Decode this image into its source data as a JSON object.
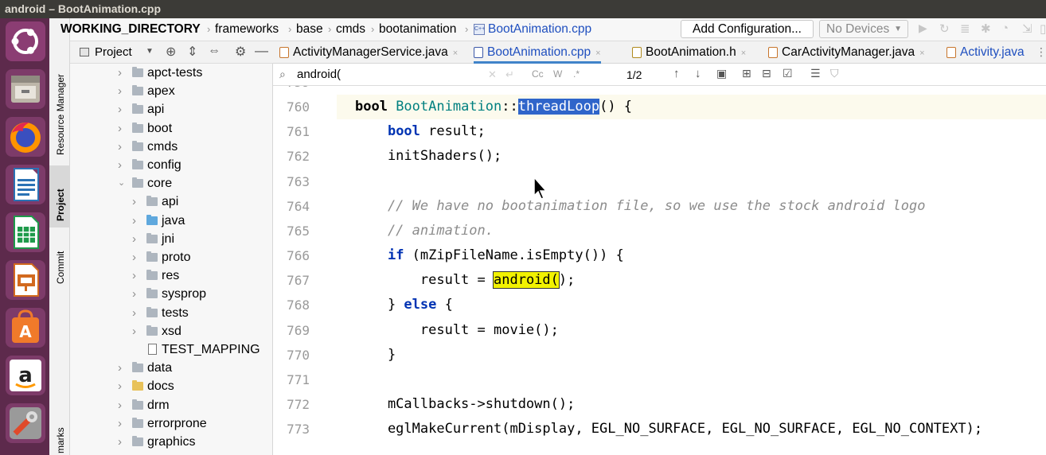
{
  "window": {
    "title": "android – BootAnimation.cpp"
  },
  "launcher": {
    "apps": [
      "ubuntu-dash-icon",
      "files-icon",
      "firefox-icon",
      "writer-icon",
      "calc-icon",
      "impress-icon",
      "software-center-icon",
      "amazon-icon",
      "settings-icon"
    ]
  },
  "tool_windows": {
    "resource_manager": "Resource Manager",
    "project": "Project",
    "commit": "Commit",
    "bookmarks": "marks"
  },
  "navbar": {
    "crumbs": [
      "WORKING_DIRECTORY",
      "frameworks",
      "base",
      "cmds",
      "bootanimation",
      "BootAnimation.cpp"
    ],
    "add_configuration": "Add Configuration...",
    "devices": "No Devices"
  },
  "project_panel": {
    "title": "Project"
  },
  "tree": [
    {
      "label": "apct-tests",
      "depth": 0,
      "expanded": false,
      "type": "folder"
    },
    {
      "label": "apex",
      "depth": 0,
      "expanded": false,
      "type": "folder"
    },
    {
      "label": "api",
      "depth": 0,
      "expanded": false,
      "type": "folder"
    },
    {
      "label": "boot",
      "depth": 0,
      "expanded": false,
      "type": "folder"
    },
    {
      "label": "cmds",
      "depth": 0,
      "expanded": false,
      "type": "folder"
    },
    {
      "label": "config",
      "depth": 0,
      "expanded": false,
      "type": "folder"
    },
    {
      "label": "core",
      "depth": 0,
      "expanded": true,
      "type": "folder"
    },
    {
      "label": "api",
      "depth": 1,
      "expanded": false,
      "type": "folder"
    },
    {
      "label": "java",
      "depth": 1,
      "expanded": false,
      "type": "folder-blue"
    },
    {
      "label": "jni",
      "depth": 1,
      "expanded": false,
      "type": "folder"
    },
    {
      "label": "proto",
      "depth": 1,
      "expanded": false,
      "type": "folder"
    },
    {
      "label": "res",
      "depth": 1,
      "expanded": false,
      "type": "folder"
    },
    {
      "label": "sysprop",
      "depth": 1,
      "expanded": false,
      "type": "folder"
    },
    {
      "label": "tests",
      "depth": 1,
      "expanded": false,
      "type": "folder"
    },
    {
      "label": "xsd",
      "depth": 1,
      "expanded": false,
      "type": "folder"
    },
    {
      "label": "TEST_MAPPING",
      "depth": 1,
      "expanded": false,
      "type": "file"
    },
    {
      "label": "data",
      "depth": 0,
      "expanded": false,
      "type": "folder"
    },
    {
      "label": "docs",
      "depth": 0,
      "expanded": false,
      "type": "folder-yellow"
    },
    {
      "label": "drm",
      "depth": 0,
      "expanded": false,
      "type": "folder"
    },
    {
      "label": "errorprone",
      "depth": 0,
      "expanded": false,
      "type": "folder"
    },
    {
      "label": "graphics",
      "depth": 0,
      "expanded": false,
      "type": "folder"
    }
  ],
  "tabs": [
    {
      "label": "ActivityManagerService.java",
      "icon": "java-class-icon",
      "active": false
    },
    {
      "label": "BootAnimation.cpp",
      "icon": "cpp-file-icon",
      "active": true
    },
    {
      "label": "BootAnimation.h",
      "icon": "header-file-icon",
      "active": false
    },
    {
      "label": "CarActivityManager.java",
      "icon": "java-class-icon",
      "active": false
    },
    {
      "label": "Activity.java",
      "icon": "java-class-icon",
      "active": false
    }
  ],
  "search": {
    "query": "android(",
    "match_counter": "1/2",
    "toggles": [
      "Cc",
      "W",
      ".*"
    ]
  },
  "editor": {
    "lines": [
      {
        "num": "759",
        "tokens": []
      },
      {
        "num": "760",
        "tokens": [
          {
            "t": "bool ",
            "c": "kw2"
          },
          {
            "t": "BootAnimation",
            "c": "cls"
          },
          {
            "t": "::",
            "c": ""
          },
          {
            "t": "threadLoop",
            "c": "selhl"
          },
          {
            "t": "() {",
            "c": ""
          }
        ],
        "current": true
      },
      {
        "num": "761",
        "tokens": [
          {
            "t": "    ",
            "c": ""
          },
          {
            "t": "bool",
            "c": "kw"
          },
          {
            "t": " result;",
            "c": ""
          }
        ]
      },
      {
        "num": "762",
        "tokens": [
          {
            "t": "    initShaders();",
            "c": ""
          }
        ]
      },
      {
        "num": "763",
        "tokens": []
      },
      {
        "num": "764",
        "tokens": [
          {
            "t": "    // We have no bootanimation file, so we use the stock android logo",
            "c": "cm"
          }
        ]
      },
      {
        "num": "765",
        "tokens": [
          {
            "t": "    // animation.",
            "c": "cm"
          }
        ]
      },
      {
        "num": "766",
        "tokens": [
          {
            "t": "    ",
            "c": ""
          },
          {
            "t": "if",
            "c": "kw"
          },
          {
            "t": " (mZipFileName.isEmpty()) {",
            "c": ""
          }
        ]
      },
      {
        "num": "767",
        "tokens": [
          {
            "t": "        result = ",
            "c": ""
          },
          {
            "t": "android(",
            "c": "findhl"
          },
          {
            "t": ");",
            "c": ""
          }
        ]
      },
      {
        "num": "768",
        "tokens": [
          {
            "t": "    } ",
            "c": ""
          },
          {
            "t": "else",
            "c": "kw"
          },
          {
            "t": " {",
            "c": ""
          }
        ]
      },
      {
        "num": "769",
        "tokens": [
          {
            "t": "        result = movie();",
            "c": ""
          }
        ]
      },
      {
        "num": "770",
        "tokens": [
          {
            "t": "    }",
            "c": ""
          }
        ]
      },
      {
        "num": "771",
        "tokens": []
      },
      {
        "num": "772",
        "tokens": [
          {
            "t": "    mCallbacks->shutdown();",
            "c": ""
          }
        ]
      },
      {
        "num": "773",
        "tokens": [
          {
            "t": "    eglMakeCurrent(mDisplay, EGL_NO_SURFACE, EGL_NO_SURFACE, EGL_NO_CONTEXT);",
            "c": ""
          }
        ]
      }
    ]
  },
  "colors": {
    "keyword": "#0033b3",
    "class": "#008080",
    "comment": "#8c8c8c",
    "selection": "#2f65ca",
    "find_highlight": "#f2f200",
    "launcher_bg": "#5d2a4c"
  }
}
